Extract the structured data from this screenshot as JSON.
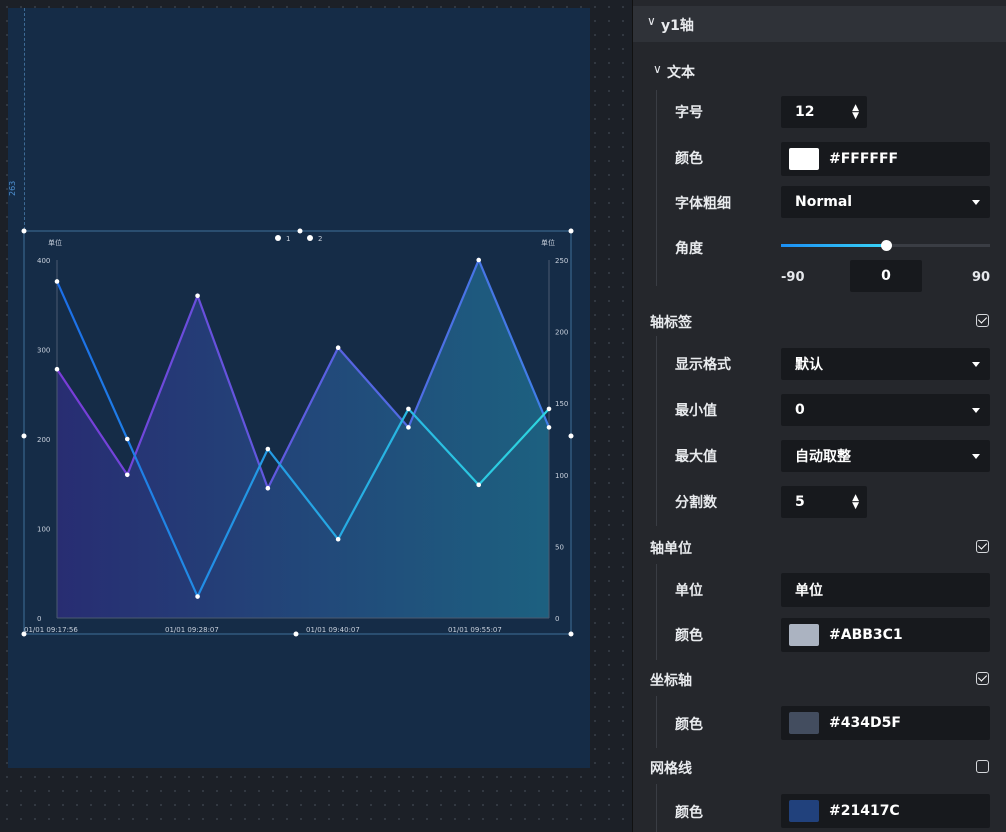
{
  "colors": {
    "line1": "#6a48e0",
    "line2": "#1f8be8",
    "line2b": "#2fd3e4",
    "accent": "#2a9df4"
  },
  "chart_data": {
    "type": "line",
    "x": [
      "01/01 09:17:56",
      "01/01 09:28:07",
      "01/01 09:40:07",
      "01/01 09:55:07"
    ],
    "legend": [
      "1",
      "2"
    ],
    "y_left": {
      "label": "单位",
      "ticks": [
        "0",
        "100",
        "200",
        "300",
        "400"
      ],
      "ylim": [
        0,
        400
      ]
    },
    "y_right": {
      "label": "单位",
      "ticks": [
        "0",
        "50",
        "100",
        "150",
        "200",
        "250"
      ],
      "ylim": [
        0,
        250
      ]
    },
    "series": [
      {
        "name": "1",
        "axis": "left",
        "values": [
          278,
          160,
          360,
          145,
          302,
          213,
          400,
          213
        ]
      },
      {
        "name": "2",
        "axis": "right",
        "values": [
          235,
          125,
          15,
          118,
          55,
          146,
          93,
          146
        ]
      }
    ]
  },
  "panel": {
    "sections": {
      "y1axis": "y1轴",
      "text": "文本",
      "axis_label": "轴标签",
      "axis_unit": "轴单位",
      "coord_axis": "坐标轴",
      "grid": "网格线"
    },
    "font_size": {
      "label": "字号",
      "value": "12"
    },
    "text_color": {
      "label": "颜色",
      "value": "#FFFFFF",
      "swatch": "#FFFFFF"
    },
    "font_weight": {
      "label": "字体粗细",
      "value": "Normal"
    },
    "angle": {
      "label": "角度",
      "min": "-90",
      "value": "0",
      "max": "90",
      "fraction": 0.5
    },
    "display_format": {
      "label": "显示格式",
      "value": "默认"
    },
    "min_value": {
      "label": "最小值",
      "value": "0"
    },
    "max_value": {
      "label": "最大值",
      "value": "自动取整"
    },
    "splits": {
      "label": "分割数",
      "value": "5"
    },
    "unit": {
      "label": "单位",
      "value": "单位"
    },
    "unit_color": {
      "label": "颜色",
      "value": "#ABB3C1",
      "swatch": "#ABB3C1"
    },
    "axis_color": {
      "label": "颜色",
      "value": "#434D5F",
      "swatch": "#434D5F"
    },
    "grid_color": {
      "label": "颜色",
      "value": "#21417C",
      "swatch": "#21417C"
    },
    "checks": {
      "axis_label": true,
      "axis_unit": true,
      "coord_axis": true,
      "grid": false
    }
  },
  "guide": {
    "value": "263"
  }
}
